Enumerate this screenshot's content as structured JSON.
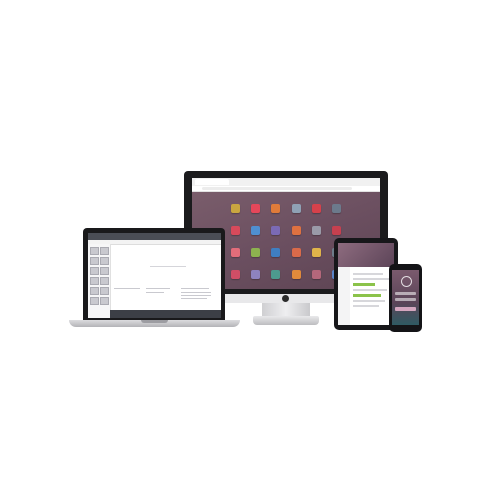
{
  "scene": {
    "description_text": ""
  },
  "monitor": {
    "app_icon_colors": [
      "#c9a640",
      "#e5475a",
      "#e07b3a",
      "#8fa1b5",
      "#d6414b",
      "#6c7a8c",
      "#d84a5b",
      "#4f8fd0",
      "#7b6ab5",
      "#df7140",
      "#9a9aa8",
      "#c7404f",
      "#e26d7a",
      "#8db24f",
      "#3f7ec2",
      "#d96a4a",
      "#e0b44a",
      "#6e7c8a",
      "#cf4e66",
      "#8e83be",
      "#4d9a8e",
      "#e08a3b",
      "#b4677b",
      "#5a84c8"
    ]
  },
  "laptop": {
    "body_text": "",
    "columns": [
      "",
      "",
      ""
    ]
  },
  "tablet": {
    "title": ""
  },
  "colors": {
    "screen_bg": "#6b4f60",
    "bezel": "#1b1b1d",
    "silver": "#dcdcdf"
  }
}
